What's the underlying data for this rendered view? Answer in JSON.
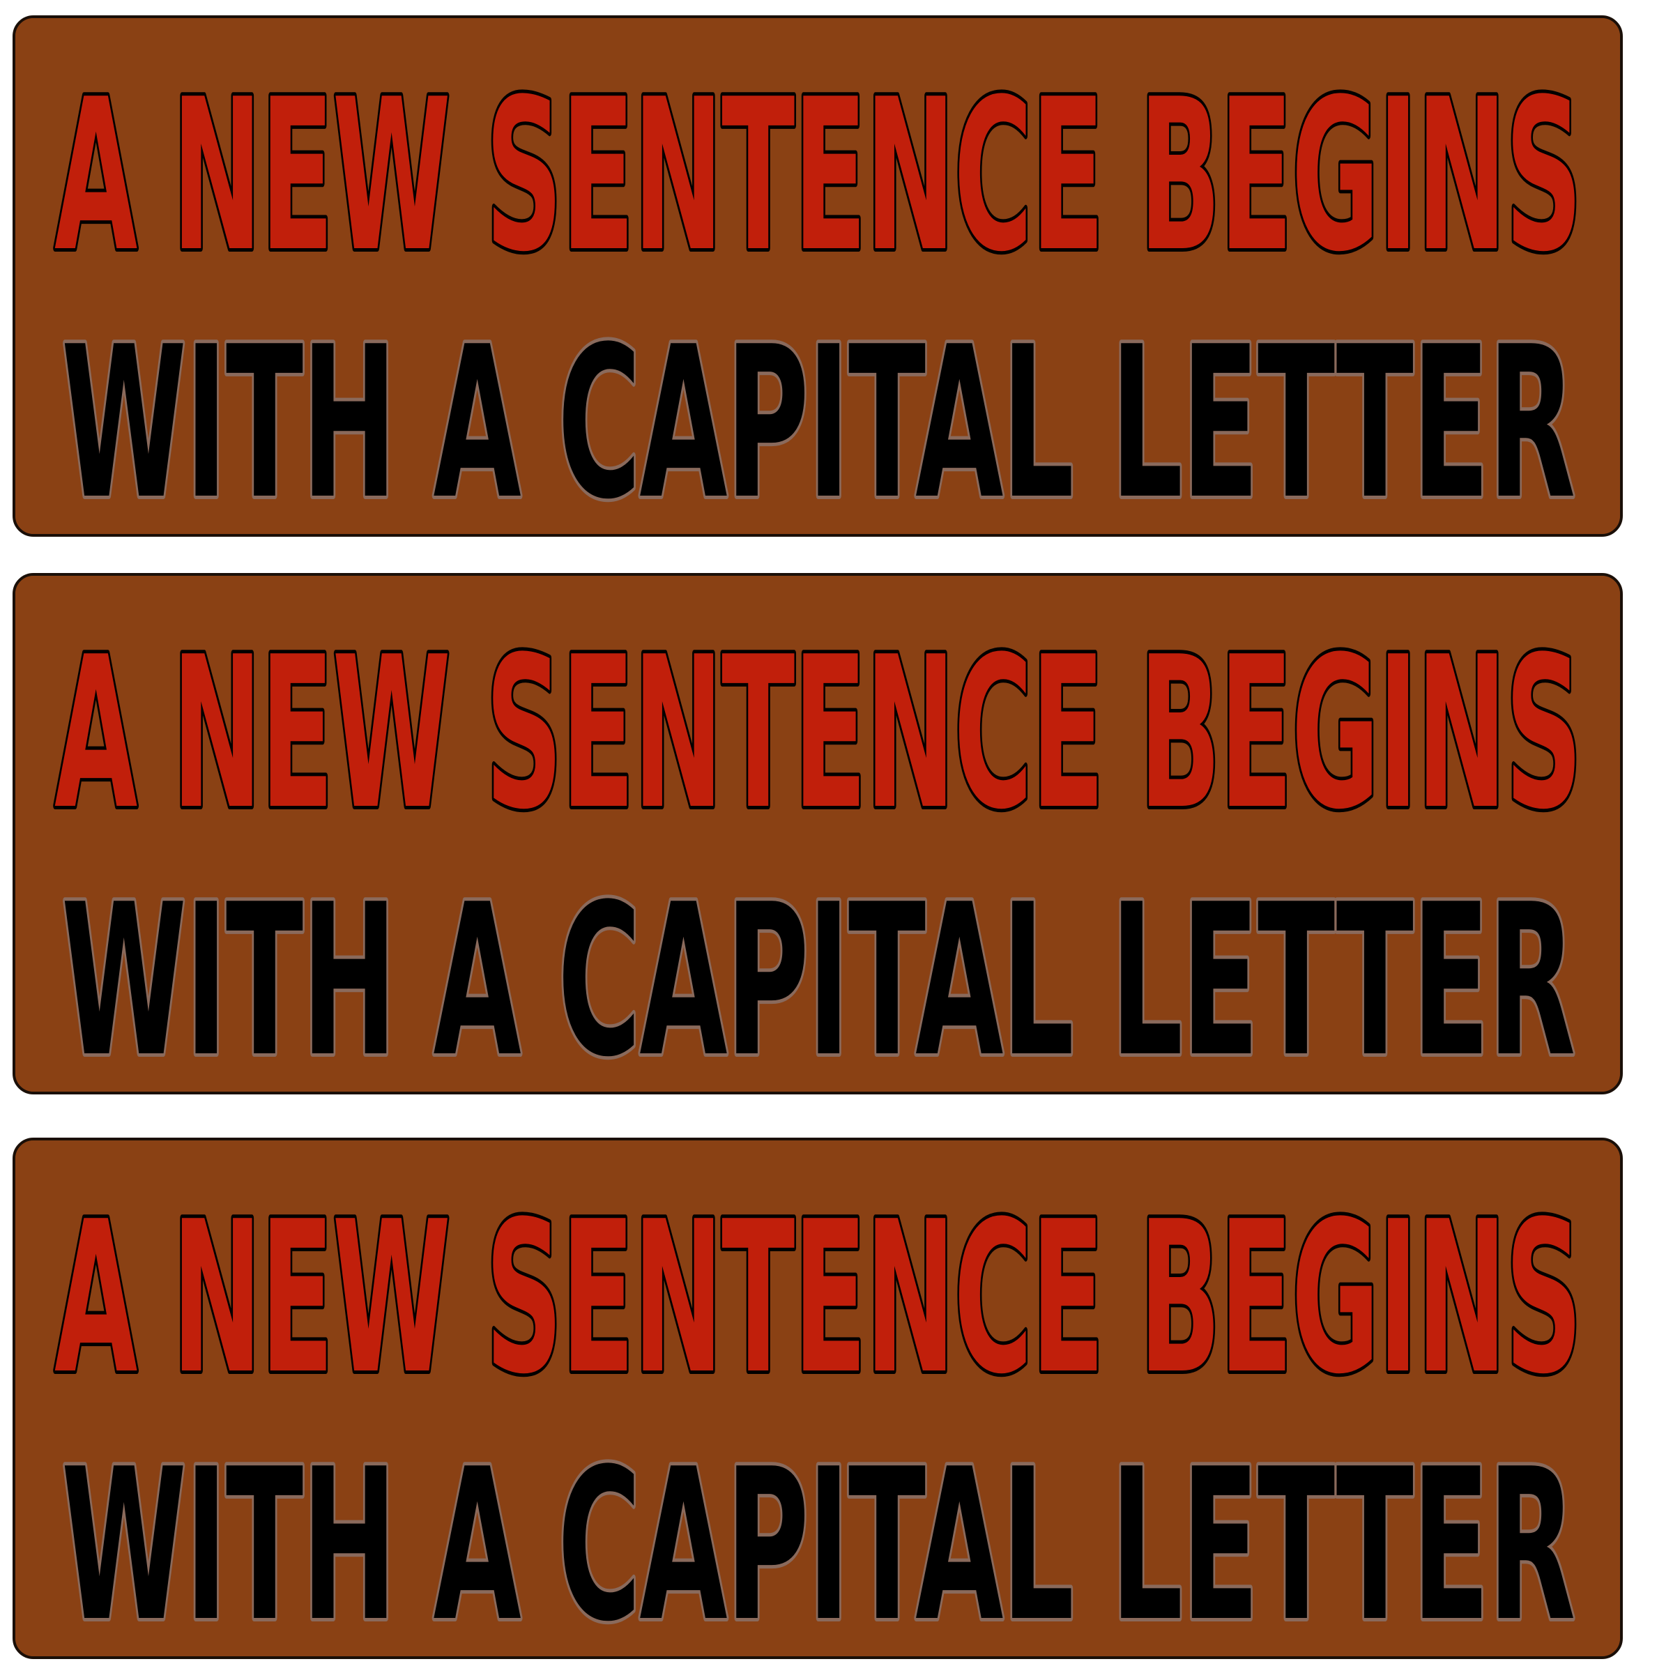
{
  "colors": {
    "background": "#ffffff",
    "sticker_fill": "#8a4114",
    "sticker_border": "#1a0f08",
    "line1_fill": "#c11f0b",
    "line1_outline": "#000000",
    "line2_fill": "#000000",
    "line2_outline": "#8a6a5c"
  },
  "stickers": [
    {
      "line1": "A NEW SENTENCE BEGINS",
      "line2": "WITH A CAPITAL LETTER"
    },
    {
      "line1": "A NEW SENTENCE BEGINS",
      "line2": "WITH A CAPITAL LETTER"
    },
    {
      "line1": "A NEW SENTENCE BEGINS",
      "line2": "WITH A CAPITAL LETTER"
    }
  ]
}
